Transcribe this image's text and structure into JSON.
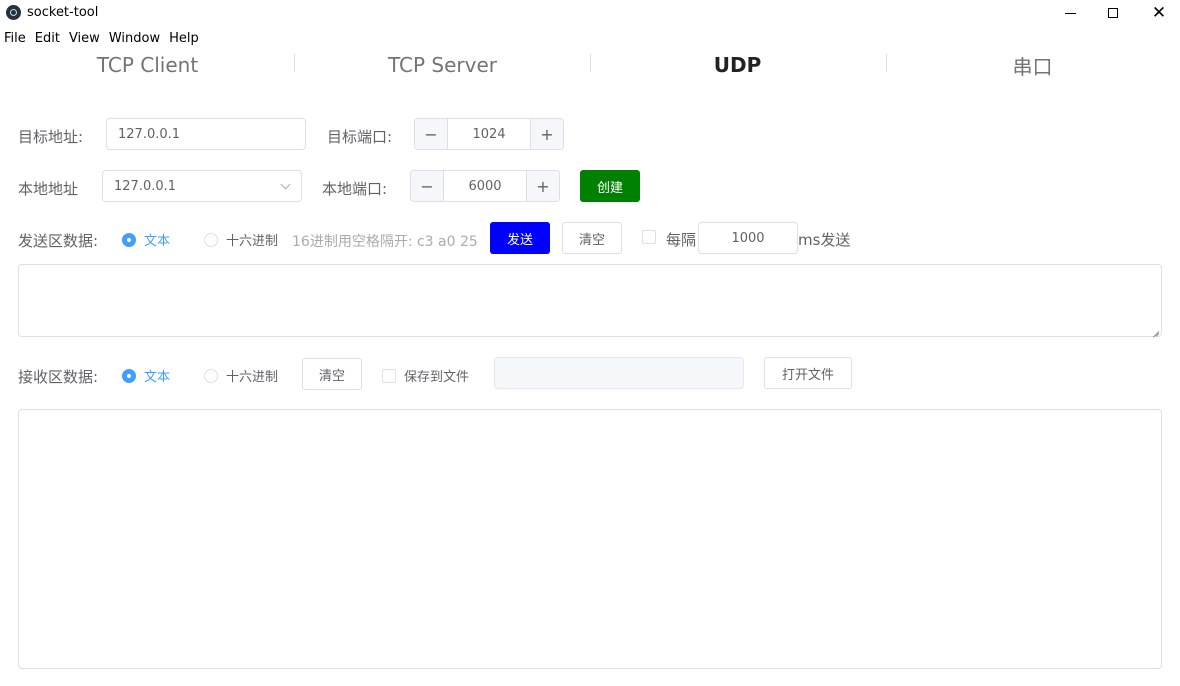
{
  "window": {
    "title": "socket-tool",
    "minimize": "minimize",
    "maximize": "maximize",
    "close": "✕"
  },
  "menu": [
    "File",
    "Edit",
    "View",
    "Window",
    "Help"
  ],
  "tabs": [
    {
      "label": "TCP Client"
    },
    {
      "label": "TCP Server"
    },
    {
      "label": "UDP",
      "active": true
    },
    {
      "label": "串口"
    }
  ],
  "target": {
    "address_label": "目标地址:",
    "address_value": "127.0.0.1",
    "port_label": "目标端口:",
    "port_value": "1024",
    "dec": "−",
    "inc": "+"
  },
  "local": {
    "address_label": "本地地址",
    "address_value": "127.0.0.1",
    "port_label": "本地端口:",
    "port_value": "6000",
    "dec": "−",
    "inc": "+",
    "create_label": "创建"
  },
  "send": {
    "label": "发送区数据:",
    "mode_text": "文本",
    "mode_hex": "十六进制",
    "selected_mode": "text",
    "hint": "16进制用空格隔开: c3 a0 25",
    "send_button": "发送",
    "clear_button": "清空",
    "interval_label": "每隔",
    "interval_value": "1000",
    "interval_unit": "ms发送",
    "interval_checked": false,
    "content": ""
  },
  "receive": {
    "label": "接收区数据:",
    "mode_text": "文本",
    "mode_hex": "十六进制",
    "selected_mode": "text",
    "clear_button": "清空",
    "save_label": "保存到文件",
    "save_checked": false,
    "file_path": "",
    "open_file_button": "打开文件",
    "content": ""
  },
  "colors": {
    "accent": "#409eff",
    "create_button": "#008000",
    "send_button": "#0000ff",
    "border": "#dcdfe6"
  }
}
